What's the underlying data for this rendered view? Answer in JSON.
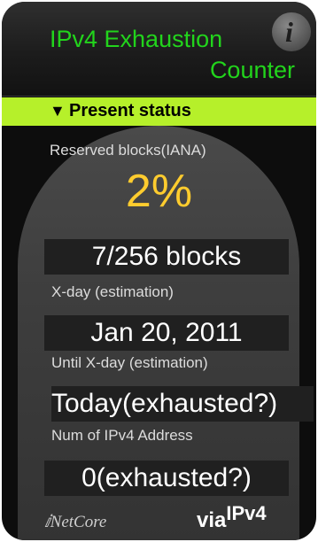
{
  "header": {
    "title": "IPv4 Exhaustion",
    "subtitle": "Counter",
    "info_icon": "info-icon"
  },
  "status": {
    "arrow": "▼",
    "label": "Present status"
  },
  "reserved": {
    "label": "Reserved blocks(IANA)",
    "percent": "2%",
    "blocks": "7/256 blocks"
  },
  "xday": {
    "label": "X-day (estimation)",
    "date": "Jan 20, 2011"
  },
  "until": {
    "label": "Until X-day (estimation)",
    "value": "Today(exhausted?)"
  },
  "num": {
    "label": "Num of IPv4 Address",
    "value": "0(exhausted?)"
  },
  "footer": {
    "brand": "NetCore",
    "via": "via",
    "ipv4": "IPv4"
  },
  "colors": {
    "title": "#22d41c",
    "status_bar": "#b6f02a",
    "percent": "#ffcc2e"
  }
}
